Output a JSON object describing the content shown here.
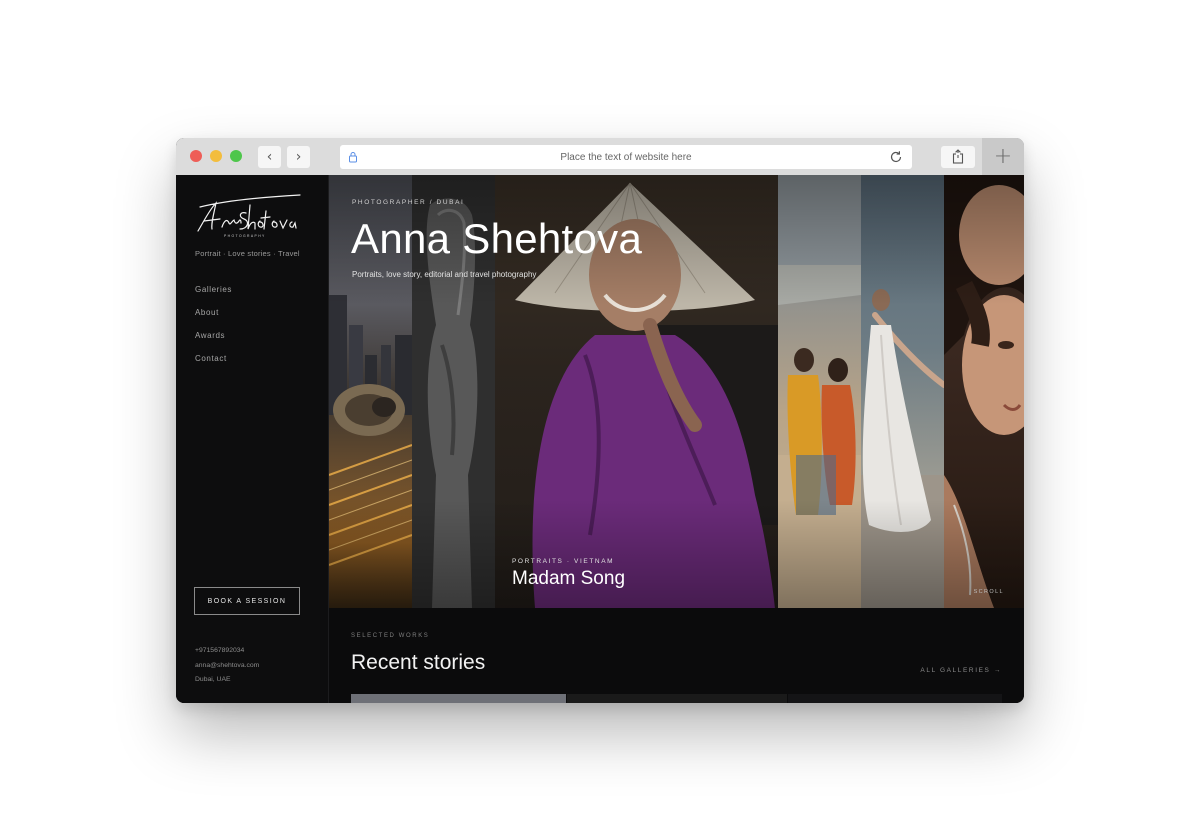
{
  "browser": {
    "url_text": "Place the text of website here",
    "back_glyph": "‹",
    "forward_glyph": "›",
    "new_tab_glyph": "+"
  },
  "sidebar": {
    "logo_alt": "Anna Shehtova Photography",
    "tagline": "Portrait · Love stories · Travel",
    "nav": [
      {
        "label": "Galleries"
      },
      {
        "label": "About"
      },
      {
        "label": "Awards"
      },
      {
        "label": "Contact"
      }
    ],
    "book_button": "BOOK A SESSION",
    "contact": {
      "phone": "+971567892034",
      "email": "anna@shehtova.com",
      "location": "Dubai, UAE"
    }
  },
  "hero": {
    "eyebrow": "PHOTOGRAPHER / DUBAI",
    "title": "Anna Shehtova",
    "subtitle": "Portraits, love story, editorial and travel photography",
    "caption_kicker": "PORTRAITS · VIETNAM",
    "caption_title": "Madam Song",
    "scroll_label": "SCROLL"
  },
  "section": {
    "kicker": "SELECTED WORKS",
    "title": "Recent stories",
    "all_link": "ALL GALLERIES →"
  },
  "colors": {
    "accent_purple": "#6b2b7a",
    "background": "#0b0b0c"
  }
}
